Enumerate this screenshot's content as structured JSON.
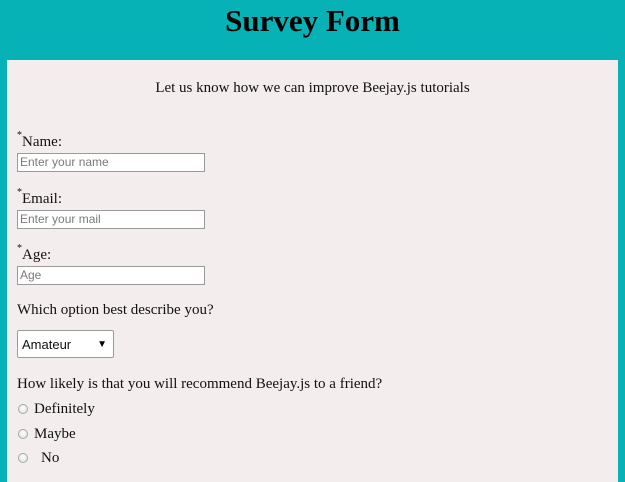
{
  "header": {
    "title": "Survey Form"
  },
  "form": {
    "description": "Let us know how we can improve Beejay.js tutorials",
    "required_marker": "*",
    "name": {
      "label": "Name:",
      "placeholder": "Enter your name",
      "value": ""
    },
    "email": {
      "label": "Email:",
      "placeholder": "Enter your mail",
      "value": ""
    },
    "age": {
      "label": "Age:",
      "placeholder": "Age",
      "value": ""
    },
    "role": {
      "label": "Which option best describe you?",
      "selected": "Amateur"
    },
    "recommend": {
      "label": "How likely is that you will recommend Beejay.js to a friend?",
      "options": [
        "Definitely",
        "Maybe",
        "No"
      ],
      "selected": null
    }
  },
  "colors": {
    "header_bg": "#06b2b6",
    "panel_bg": "#f3eded"
  }
}
